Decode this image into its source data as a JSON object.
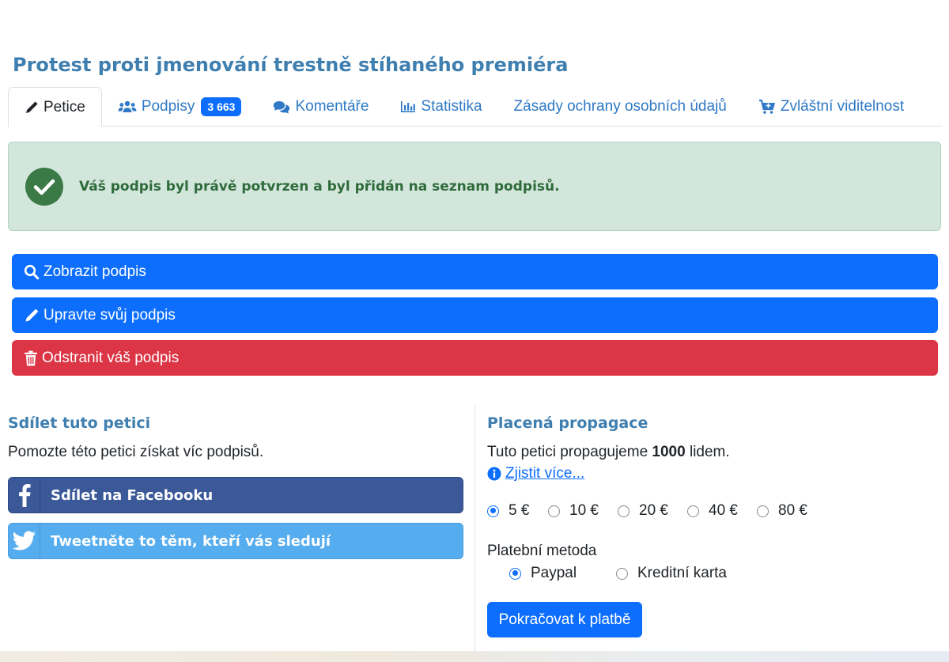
{
  "petition": {
    "title": "Protest proti jmenování trestně stíhaného premiéra"
  },
  "tabs": [
    {
      "label": "Petice",
      "icon": "pencil-icon",
      "active": true
    },
    {
      "label": "Podpisy",
      "icon": "users-icon",
      "badge": "3 663"
    },
    {
      "label": "Komentáře",
      "icon": "comments-icon"
    },
    {
      "label": "Statistika",
      "icon": "bar-chart-icon"
    },
    {
      "label": "Zásady ochrany osobních údajů"
    },
    {
      "label": "Zvláštní viditelnost",
      "icon": "cart-plus-icon"
    }
  ],
  "alert": {
    "message": "Váš podpis byl právě potvrzen a byl přidán na seznam podpisů.",
    "icon": "check-circle-icon"
  },
  "actions": {
    "view": "Zobrazit podpis",
    "edit": "Upravte svůj podpis",
    "delete": "Odstranit váš podpis"
  },
  "share": {
    "heading": "Sdílet tuto petici",
    "description": "Pomozte této petici získat víc podpisů.",
    "facebook": "Sdílet na Facebooku",
    "twitter": "Tweetněte to těm, kteří vás sledují"
  },
  "promo": {
    "heading": "Placená propagace",
    "text_before": "Tuto petici propagujeme",
    "count": "1000",
    "text_after": "lidem.",
    "learn_more": "Zjistit více...",
    "amounts": [
      {
        "label": "5 €",
        "selected": true
      },
      {
        "label": "10 €",
        "selected": false
      },
      {
        "label": "20 €",
        "selected": false
      },
      {
        "label": "40 €",
        "selected": false
      },
      {
        "label": "80 €",
        "selected": false
      }
    ],
    "payment_label": "Platební metoda",
    "payment_methods": [
      {
        "label": "Paypal",
        "selected": true
      },
      {
        "label": "Kreditní karta",
        "selected": false
      }
    ],
    "continue": "Pokračovat k platbě"
  },
  "colors": {
    "primary": "#0d6efd",
    "danger": "#dc3545",
    "heading": "#3f7fb0",
    "success_bg": "#d2e6dc",
    "facebook": "#3b5998",
    "twitter": "#55acee"
  }
}
